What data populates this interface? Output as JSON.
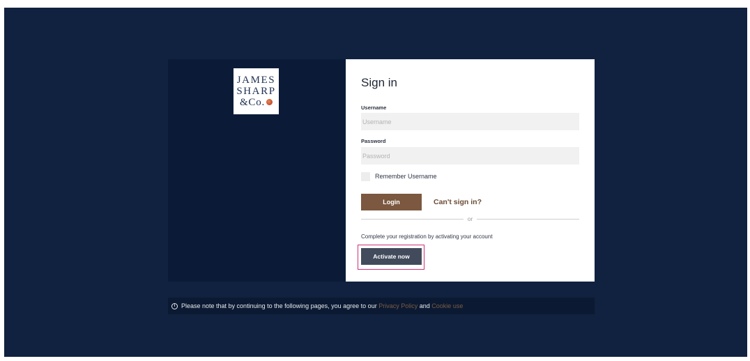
{
  "brand": {
    "logo_line1": "JAMES",
    "logo_line2": "SHARP",
    "logo_line3": "&Co.",
    "logo_dot_color": "#c9552f"
  },
  "signin": {
    "title": "Sign in",
    "username_label": "Username",
    "username_placeholder": "Username",
    "password_label": "Password",
    "password_placeholder": "Password",
    "remember_label": "Remember Username",
    "login_label": "Login",
    "cant_signin_label": "Can't sign in?",
    "or_label": "or",
    "activate_message": "Complete your registration by activating your account",
    "activate_label": "Activate now"
  },
  "notice": {
    "text_before": "Please note that by continuing to the following pages, you agree to our",
    "privacy_label": "Privacy Policy",
    "and_label": "and",
    "cookie_label": "Cookie use"
  },
  "colors": {
    "page_background": "#10223f",
    "brand_panel": "#0b1b37",
    "login_button": "#7b583f",
    "activate_button": "#424b5c",
    "highlight_border": "#cf2f77",
    "link": "#7a5b45"
  },
  "icons": {
    "notice_icon": "info-circle-icon"
  }
}
